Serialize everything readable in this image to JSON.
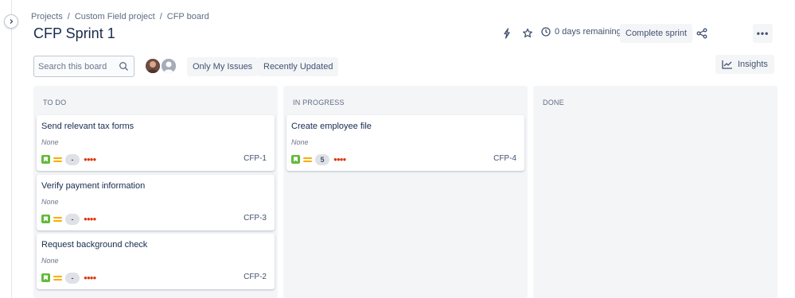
{
  "breadcrumb": {
    "items": [
      "Projects",
      "Custom Field project",
      "CFP board"
    ],
    "separator": "/"
  },
  "sprint": {
    "title": "CFP Sprint 1",
    "days_remaining": "0 days remaining",
    "complete_label": "Complete sprint",
    "more_label": "•••"
  },
  "toolbar": {
    "search_placeholder": "Search this board",
    "filters": [
      "Only My Issues",
      "Recently Updated"
    ],
    "insights_label": "Insights"
  },
  "columns": [
    {
      "title": "TO DO",
      "cards": [
        {
          "summary": "Send relevant tax forms",
          "field": "None",
          "estimate": "-",
          "key": "CFP-1"
        },
        {
          "summary": "Verify payment information",
          "field": "None",
          "estimate": "-",
          "key": "CFP-3"
        },
        {
          "summary": "Request background check",
          "field": "None",
          "estimate": "-",
          "key": "CFP-2"
        }
      ]
    },
    {
      "title": "IN PROGRESS",
      "cards": [
        {
          "summary": "Create employee file",
          "field": "None",
          "estimate": "5",
          "key": "CFP-4"
        }
      ]
    },
    {
      "title": "DONE",
      "cards": []
    }
  ],
  "colors": {
    "story": "#63ba3c",
    "priority_medium": "#ffab00",
    "dots": "#de350b",
    "column_bg": "#f4f5f7"
  },
  "icons": {
    "collapse": "chevron-right-icon",
    "automation": "lightning-icon",
    "star": "star-icon",
    "clock": "clock-icon",
    "share": "share-icon",
    "search": "search-icon",
    "insights": "chart-line-icon",
    "story": "story-icon",
    "priority": "priority-medium-icon"
  }
}
